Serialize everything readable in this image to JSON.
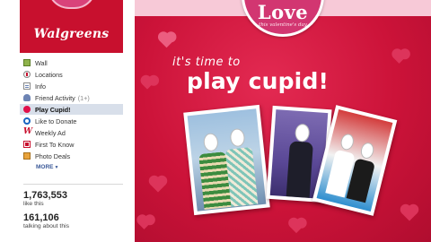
{
  "profile": {
    "logo_text": "Walgreens"
  },
  "nav": {
    "items": [
      {
        "label": "Wall",
        "icon": "wall-icon"
      },
      {
        "label": "Locations",
        "icon": "location-pin-icon"
      },
      {
        "label": "Info",
        "icon": "info-icon"
      },
      {
        "label": "Friend Activity",
        "count": "(1+)",
        "icon": "friend-activity-icon"
      },
      {
        "label": "Play Cupid!",
        "icon": "heart-icon",
        "active": true
      },
      {
        "label": "Like to Donate",
        "icon": "donate-icon"
      },
      {
        "label": "Weekly Ad",
        "icon": "walgreens-w-icon"
      },
      {
        "label": "First To Know",
        "icon": "first-to-know-icon"
      },
      {
        "label": "Photo Deals",
        "icon": "photo-icon"
      }
    ],
    "more_label": "MORE",
    "more_icon": "caret-down-icon"
  },
  "stats": {
    "likes_count": "1,763,553",
    "likes_label": "like this",
    "talking_count": "161,106",
    "talking_label": "talking about this"
  },
  "banner": {
    "badge_title": "Love",
    "badge_subtitle": "this valentine's day",
    "tagline": "it's time to",
    "headline": "play cupid!"
  },
  "colors": {
    "brand_red": "#c8102e",
    "banner_red": "#d0163f",
    "badge_pink": "#d23671",
    "band_pink": "#f7c9d7",
    "active_nav": "#d8dfea",
    "link_blue": "#3b5998"
  }
}
